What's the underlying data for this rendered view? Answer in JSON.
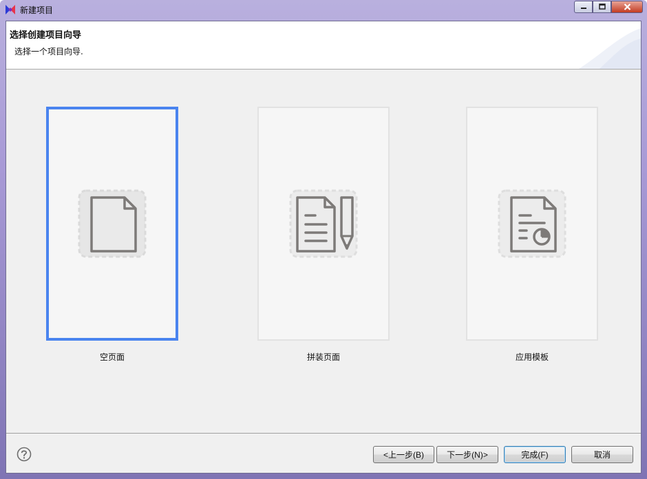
{
  "window": {
    "title": "新建项目"
  },
  "header": {
    "title": "选择创建项目向导",
    "description": "选择一个项目向导."
  },
  "cards": [
    {
      "label": "空页面",
      "icon": "blank-page-icon",
      "selected": true
    },
    {
      "label": "拼装页面",
      "icon": "page-with-pencil-icon",
      "selected": false
    },
    {
      "label": "应用模板",
      "icon": "template-report-icon",
      "selected": false
    }
  ],
  "footer": {
    "help_icon": "help-icon",
    "back_label": "<上一步(B)",
    "next_label": "下一步(N)>",
    "finish_label": "完成(F)",
    "cancel_label": "取消"
  },
  "colors": {
    "selection_border": "#4a84ef",
    "card_background": "#f6f6f6",
    "dialog_background": "#f0f0f0"
  }
}
